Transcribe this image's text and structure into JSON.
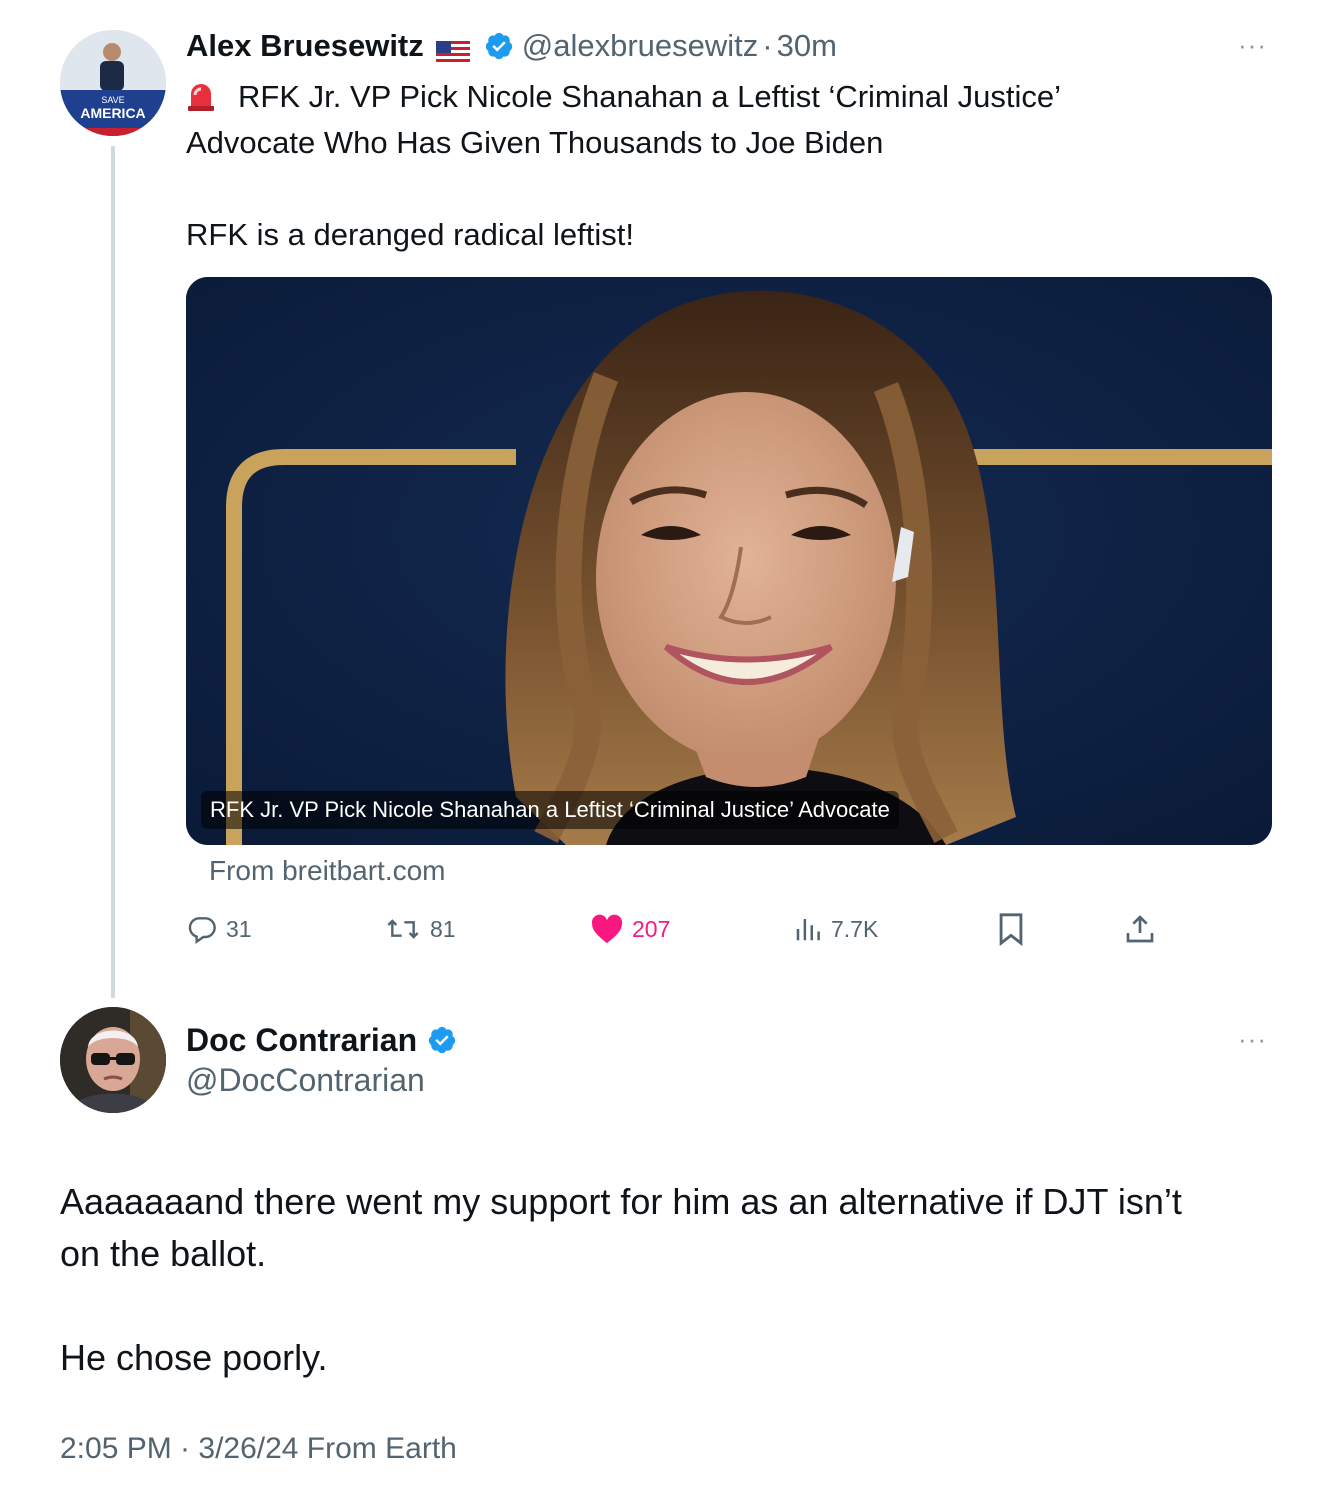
{
  "tweet1": {
    "author_name": "Alex Bruesewitz",
    "handle": "@alexbruesewitz",
    "separator": "·",
    "time": "30m",
    "avatar_text": {
      "top": "SAVE",
      "main": "AMERICA"
    },
    "text_lines": [
      "RFK Jr. VP Pick Nicole Shanahan a Leftist ‘Criminal Justice’",
      "Advocate Who Has Given Thousands to Joe Biden",
      "RFK is a deranged radical leftist!"
    ],
    "card": {
      "caption": "RFK Jr. VP Pick Nicole Shanahan a Leftist ‘Criminal Justice’ Advocate",
      "source": "From breitbart.com"
    },
    "actions": {
      "replies": "31",
      "reposts": "81",
      "likes": "207",
      "views": "7.7K"
    },
    "more": "···"
  },
  "tweet2": {
    "author_name": "Doc Contrarian",
    "handle": "@DocContrarian",
    "body_lines": [
      "Aaaaaaand there went my support for him as an alternative if DJT isn’t",
      "on the ballot.",
      "He chose poorly."
    ],
    "timestamp": "2:05 PM · 3/26/24 From Earth",
    "more": "···"
  },
  "colors": {
    "verified": "#1d9bf0",
    "like": "#f91880",
    "secondary_text": "#536471",
    "thread_line": "#cfd9de"
  },
  "icons": [
    "reply-icon",
    "repost-icon",
    "heart-icon",
    "views-icon",
    "bookmark-icon",
    "share-icon",
    "verified-badge-icon",
    "siren-icon",
    "us-flag-icon",
    "more-icon"
  ]
}
